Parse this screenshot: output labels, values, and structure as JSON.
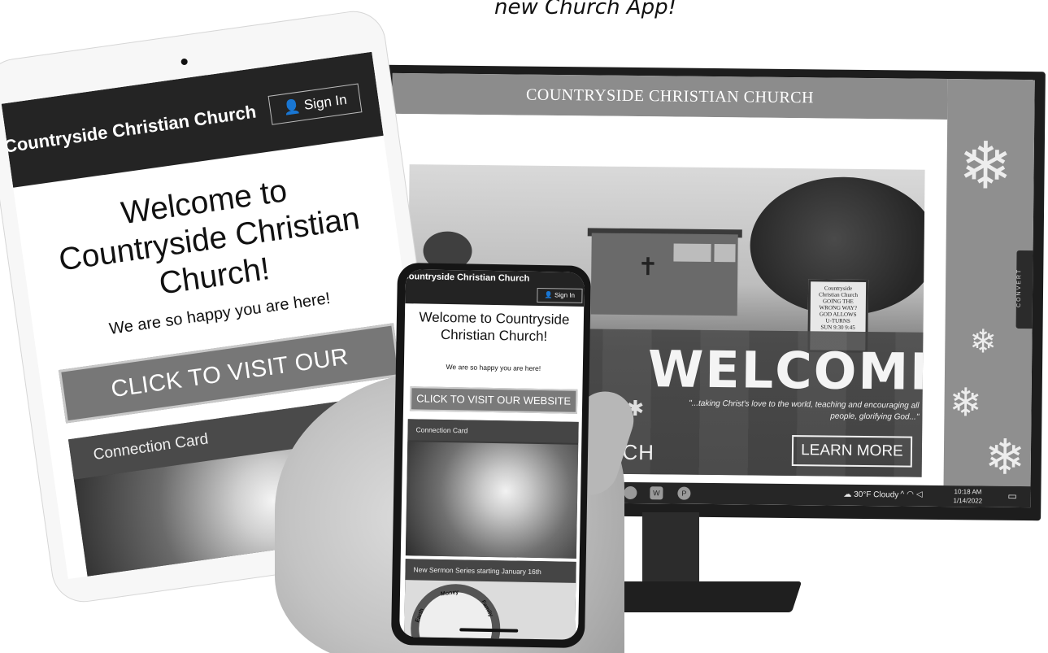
{
  "caption": "new Church App!",
  "desktop": {
    "site_title": "COUNTRYSIDE CHRISTIAN CHURCH",
    "hero": {
      "sign_lines": [
        "Countryside",
        "Christian Church",
        "GOING THE",
        "WRONG WAY?",
        "GOD ALLOWS",
        "U-TURNS",
        "SUN 9:30  9:45"
      ],
      "headline": "WELCOME",
      "tagline": "\"...taking Christ's love to the world, teaching and encouraging all people, glorifying God...\"",
      "cta": "LEARN MORE",
      "logo_partial": "URCH",
      "next_arrow": "›"
    },
    "side_tab": "CONVERT",
    "taskbar": {
      "word_icon": "W",
      "ppt_icon": "P",
      "weather": "30°F Cloudy",
      "time": "10:18 AM",
      "date": "1/14/2022"
    }
  },
  "tablet": {
    "brand": "Countryside Christian Church",
    "signin": "Sign In",
    "welcome": "Welcome to Countryside Christian Church!",
    "subtitle": "We are so happy you are here!",
    "visit_button": "CLICK TO VISIT OUR WEBSITE",
    "card_title": "Connection Card"
  },
  "phone": {
    "brand": "Countryside Christian Church",
    "signin": "Sign In",
    "welcome": "Welcome to Countryside Christian Church!",
    "subtitle": "We are so happy you are here!",
    "visit_button": "CLICK TO VISIT OUR WEBSITE",
    "card1_title": "Connection Card",
    "card2_title": "New Sermon Series starting January 16th",
    "logo_words": [
      "Earth",
      "Money",
      "Family"
    ]
  }
}
